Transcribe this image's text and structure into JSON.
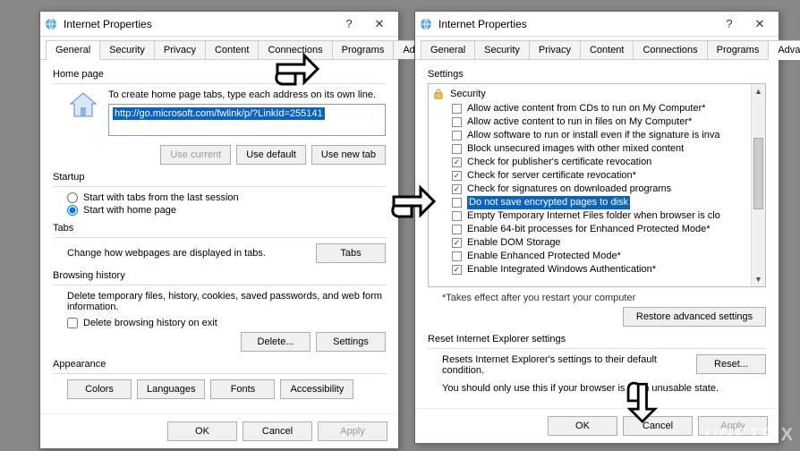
{
  "watermark": "UGETFIX",
  "left": {
    "title": "Internet Properties",
    "tabs": [
      "General",
      "Security",
      "Privacy",
      "Content",
      "Connections",
      "Programs",
      "Advanced"
    ],
    "active_tab": 0,
    "home": {
      "label": "Home page",
      "instruction": "To create home page tabs, type each address on its own line.",
      "url": "http://go.microsoft.com/fwlink/p/?LinkId=255141",
      "btn_current": "Use current",
      "btn_default": "Use default",
      "btn_newtab": "Use new tab"
    },
    "startup": {
      "label": "Startup",
      "opt_last": "Start with tabs from the last session",
      "opt_home": "Start with home page",
      "selected": "home"
    },
    "tabs_section": {
      "label": "Tabs",
      "text": "Change how webpages are displayed in tabs.",
      "btn": "Tabs"
    },
    "history": {
      "label": "Browsing history",
      "text": "Delete temporary files, history, cookies, saved passwords, and web form information.",
      "chk_exit": "Delete browsing history on exit",
      "btn_delete": "Delete...",
      "btn_settings": "Settings"
    },
    "appearance": {
      "label": "Appearance",
      "btn_colors": "Colors",
      "btn_lang": "Languages",
      "btn_fonts": "Fonts",
      "btn_access": "Accessibility"
    },
    "footer": {
      "ok": "OK",
      "cancel": "Cancel",
      "apply": "Apply"
    }
  },
  "right": {
    "title": "Internet Properties",
    "tabs": [
      "General",
      "Security",
      "Privacy",
      "Content",
      "Connections",
      "Programs",
      "Advanced"
    ],
    "active_tab": 6,
    "settings": {
      "label": "Settings",
      "node": "Security",
      "items": [
        {
          "checked": false,
          "label": "Allow active content from CDs to run on My Computer*"
        },
        {
          "checked": false,
          "label": "Allow active content to run in files on My Computer*"
        },
        {
          "checked": false,
          "label": "Allow software to run or install even if the signature is inva"
        },
        {
          "checked": false,
          "label": "Block unsecured images with other mixed content"
        },
        {
          "checked": true,
          "label": "Check for publisher's certificate revocation"
        },
        {
          "checked": true,
          "label": "Check for server certificate revocation*"
        },
        {
          "checked": true,
          "label": "Check for signatures on downloaded programs"
        },
        {
          "checked": false,
          "label": "Do not save encrypted pages to disk",
          "selected": true
        },
        {
          "checked": false,
          "label": "Empty Temporary Internet Files folder when browser is clo"
        },
        {
          "checked": false,
          "label": "Enable 64-bit processes for Enhanced Protected Mode*"
        },
        {
          "checked": true,
          "label": "Enable DOM Storage"
        },
        {
          "checked": false,
          "label": "Enable Enhanced Protected Mode*"
        },
        {
          "checked": true,
          "label": "Enable Integrated Windows Authentication*"
        }
      ],
      "note": "*Takes effect after you restart your computer",
      "btn_restore": "Restore advanced settings"
    },
    "reset": {
      "label": "Reset Internet Explorer settings",
      "text": "Resets Internet Explorer's settings to their default condition.",
      "btn": "Reset...",
      "warn": "You should only use this if your browser is in an unusable state."
    },
    "footer": {
      "ok": "OK",
      "cancel": "Cancel",
      "apply": "Apply"
    }
  }
}
